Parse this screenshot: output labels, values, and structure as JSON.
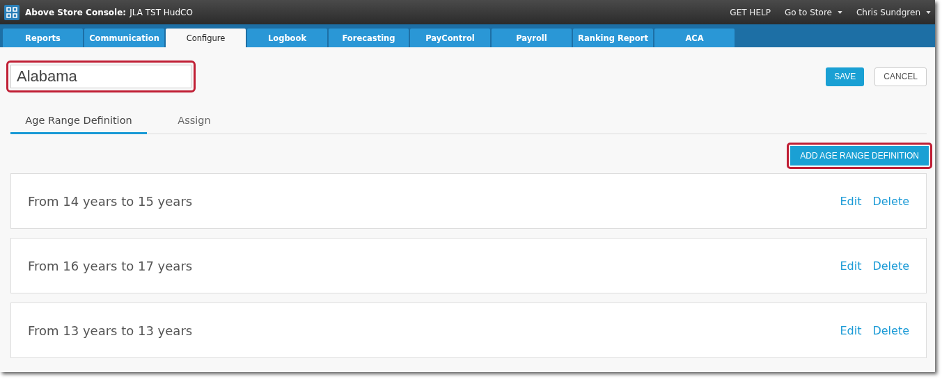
{
  "header": {
    "app_title": "Above Store Console:",
    "store": "JLA TST HudCO",
    "links": [
      {
        "label": "GET HELP",
        "dropdown": false
      },
      {
        "label": "Go to Store",
        "dropdown": true
      },
      {
        "label": "Chris Sundgren",
        "dropdown": true
      }
    ]
  },
  "nav_tabs": [
    {
      "label": "Reports",
      "selected": false
    },
    {
      "label": "Communication",
      "selected": false
    },
    {
      "label": "Configure",
      "selected": true
    },
    {
      "label": "Logbook",
      "selected": false
    },
    {
      "label": "Forecasting",
      "selected": false
    },
    {
      "label": "PayControl",
      "selected": false
    },
    {
      "label": "Payroll",
      "selected": false
    },
    {
      "label": "Ranking Report",
      "selected": false
    },
    {
      "label": "ACA",
      "selected": false
    }
  ],
  "name_field": {
    "value": "Alabama",
    "highlighted": true
  },
  "buttons": {
    "save": "SAVE",
    "cancel": "CANCEL"
  },
  "sub_tabs": [
    {
      "label": "Age Range Definition",
      "selected": true
    },
    {
      "label": "Assign",
      "selected": false
    }
  ],
  "add_button": {
    "label": "ADD AGE RANGE DEFINITION",
    "highlighted": true
  },
  "ranges": [
    {
      "text": "From 14 years to 15 years",
      "edit": "Edit",
      "delete": "Delete"
    },
    {
      "text": "From 16 years to 17 years",
      "edit": "Edit",
      "delete": "Delete"
    },
    {
      "text": "From 13 years to 13 years",
      "edit": "Edit",
      "delete": "Delete"
    }
  ]
}
